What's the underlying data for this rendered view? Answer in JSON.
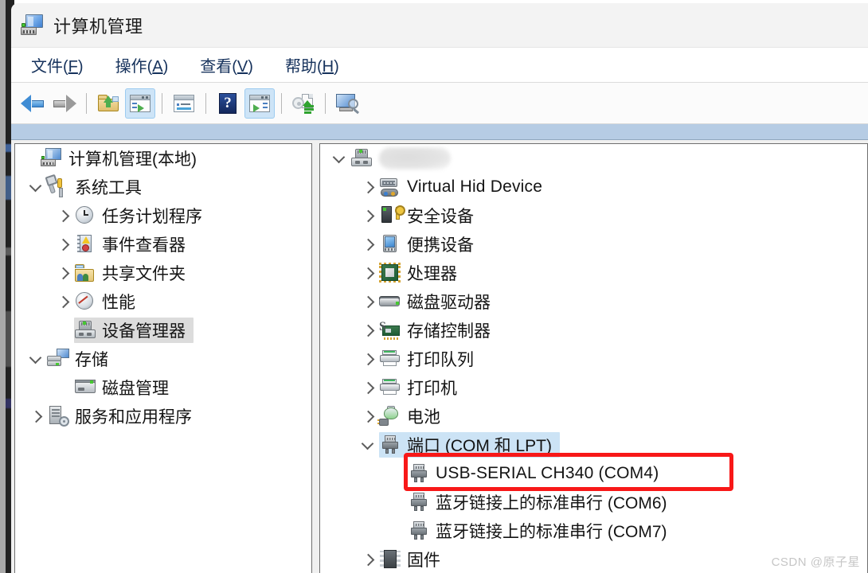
{
  "window": {
    "title": "计算机管理",
    "icon": "computer-management-icon"
  },
  "menubar": [
    {
      "label": "文件",
      "accel": "F"
    },
    {
      "label": "操作",
      "accel": "A"
    },
    {
      "label": "查看",
      "accel": "V"
    },
    {
      "label": "帮助",
      "accel": "H"
    }
  ],
  "toolbar": {
    "buttons": [
      {
        "name": "back-button",
        "icon": "back-arrow-icon",
        "active": false
      },
      {
        "name": "forward-button",
        "icon": "forward-arrow-icon",
        "active": false
      },
      {
        "name": "up-one-level-button",
        "icon": "folder-up-icon",
        "active": false
      },
      {
        "name": "show-hide-tree-button",
        "icon": "console-tree-icon",
        "active": true
      },
      {
        "name": "properties-button",
        "icon": "properties-icon",
        "active": false
      },
      {
        "name": "help-button",
        "icon": "help-question-icon",
        "active": false
      },
      {
        "name": "show-hide-action-pane-button",
        "icon": "action-pane-icon",
        "active": true
      },
      {
        "name": "scan-for-hardware-changes-button",
        "icon": "scan-hardware-icon",
        "active": false
      },
      {
        "name": "remote-connect-button",
        "icon": "monitor-search-icon",
        "active": false
      }
    ]
  },
  "left_tree": [
    {
      "label": "计算机管理(本地)",
      "icon": "computer-management-icon",
      "indent": 0,
      "chev": "blank",
      "selected": false
    },
    {
      "label": "系统工具",
      "icon": "system-tools-icon",
      "indent": 1,
      "chev": "expanded",
      "selected": false
    },
    {
      "label": "任务计划程序",
      "icon": "task-scheduler-icon",
      "indent": 2,
      "chev": "collapsed",
      "selected": false
    },
    {
      "label": "事件查看器",
      "icon": "event-viewer-icon",
      "indent": 2,
      "chev": "collapsed",
      "selected": false
    },
    {
      "label": "共享文件夹",
      "icon": "shared-folders-icon",
      "indent": 2,
      "chev": "collapsed",
      "selected": false
    },
    {
      "label": "性能",
      "icon": "performance-icon",
      "indent": 2,
      "chev": "collapsed",
      "selected": false
    },
    {
      "label": "设备管理器",
      "icon": "device-manager-icon",
      "indent": 2,
      "chev": "blank",
      "selected": true
    },
    {
      "label": "存储",
      "icon": "storage-icon",
      "indent": 1,
      "chev": "expanded",
      "selected": false
    },
    {
      "label": "磁盘管理",
      "icon": "disk-management-icon",
      "indent": 2,
      "chev": "blank",
      "selected": false
    },
    {
      "label": "服务和应用程序",
      "icon": "services-apps-icon",
      "indent": 1,
      "chev": "collapsed",
      "selected": false
    }
  ],
  "device_tree": [
    {
      "label": "",
      "icon": "computer-root-icon",
      "indent": 0,
      "chev": "expanded",
      "selected": false,
      "blurred": true,
      "en": false
    },
    {
      "label": "Virtual Hid Device",
      "icon": "virtual-hid-icon",
      "indent": 1,
      "chev": "collapsed",
      "selected": false,
      "blurred": false,
      "en": true
    },
    {
      "label": "安全设备",
      "icon": "security-device-icon",
      "indent": 1,
      "chev": "collapsed",
      "selected": false,
      "blurred": false,
      "en": false
    },
    {
      "label": "便携设备",
      "icon": "portable-device-icon",
      "indent": 1,
      "chev": "collapsed",
      "selected": false,
      "blurred": false,
      "en": false
    },
    {
      "label": "处理器",
      "icon": "processor-icon",
      "indent": 1,
      "chev": "collapsed",
      "selected": false,
      "blurred": false,
      "en": false
    },
    {
      "label": "磁盘驱动器",
      "icon": "disk-drive-icon",
      "indent": 1,
      "chev": "collapsed",
      "selected": false,
      "blurred": false,
      "en": false
    },
    {
      "label": "存储控制器",
      "icon": "storage-controller-icon",
      "indent": 1,
      "chev": "collapsed",
      "selected": false,
      "blurred": false,
      "en": false
    },
    {
      "label": "打印队列",
      "icon": "print-queue-icon",
      "indent": 1,
      "chev": "collapsed",
      "selected": false,
      "blurred": false,
      "en": false
    },
    {
      "label": "打印机",
      "icon": "printer-icon",
      "indent": 1,
      "chev": "collapsed",
      "selected": false,
      "blurred": false,
      "en": false
    },
    {
      "label": "电池",
      "icon": "battery-icon",
      "indent": 1,
      "chev": "collapsed",
      "selected": false,
      "blurred": false,
      "en": false
    },
    {
      "label": "端口 (COM 和 LPT)",
      "icon": "ports-icon",
      "indent": 1,
      "chev": "expanded",
      "selected": true,
      "blurred": false,
      "en": false
    },
    {
      "label": "USB-SERIAL CH340 (COM4)",
      "icon": "serial-port-icon",
      "indent": 2,
      "chev": "blank",
      "selected": false,
      "blurred": false,
      "en": true
    },
    {
      "label": "蓝牙链接上的标准串行 (COM6)",
      "icon": "serial-port-icon",
      "indent": 2,
      "chev": "blank",
      "selected": false,
      "blurred": false,
      "en": false
    },
    {
      "label": "蓝牙链接上的标准串行 (COM7)",
      "icon": "serial-port-icon",
      "indent": 2,
      "chev": "blank",
      "selected": false,
      "blurred": false,
      "en": false
    },
    {
      "label": "固件",
      "icon": "firmware-icon",
      "indent": 1,
      "chev": "collapsed",
      "selected": false,
      "blurred": false,
      "en": false
    }
  ],
  "annotation": {
    "target_label": "USB-SERIAL CH340 (COM4)",
    "box_color": "#f81818"
  },
  "watermark": {
    "text": "CSDN @原子星",
    "color": "#c6c6c6"
  },
  "colors": {
    "console_band": "#b6cce4",
    "selection_blue": "#cce3f5",
    "selection_gray": "#dcdcdc",
    "menu_text": "#16325c"
  }
}
